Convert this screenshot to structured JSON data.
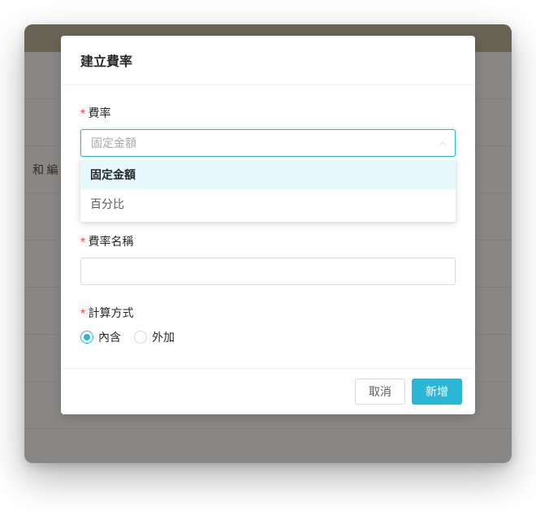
{
  "backdrop": {
    "label_fragment": "和 編"
  },
  "modal": {
    "title": "建立費率",
    "fields": {
      "rate": {
        "label": "費率",
        "selected_value": "固定金額",
        "options": [
          "固定金額",
          "百分比"
        ]
      },
      "rate_name": {
        "label": "費率名稱",
        "value": ""
      },
      "calc_method": {
        "label": "計算方式",
        "options": [
          "內含",
          "外加"
        ],
        "selected": "內含"
      }
    },
    "buttons": {
      "cancel": "取消",
      "submit": "新增"
    }
  }
}
